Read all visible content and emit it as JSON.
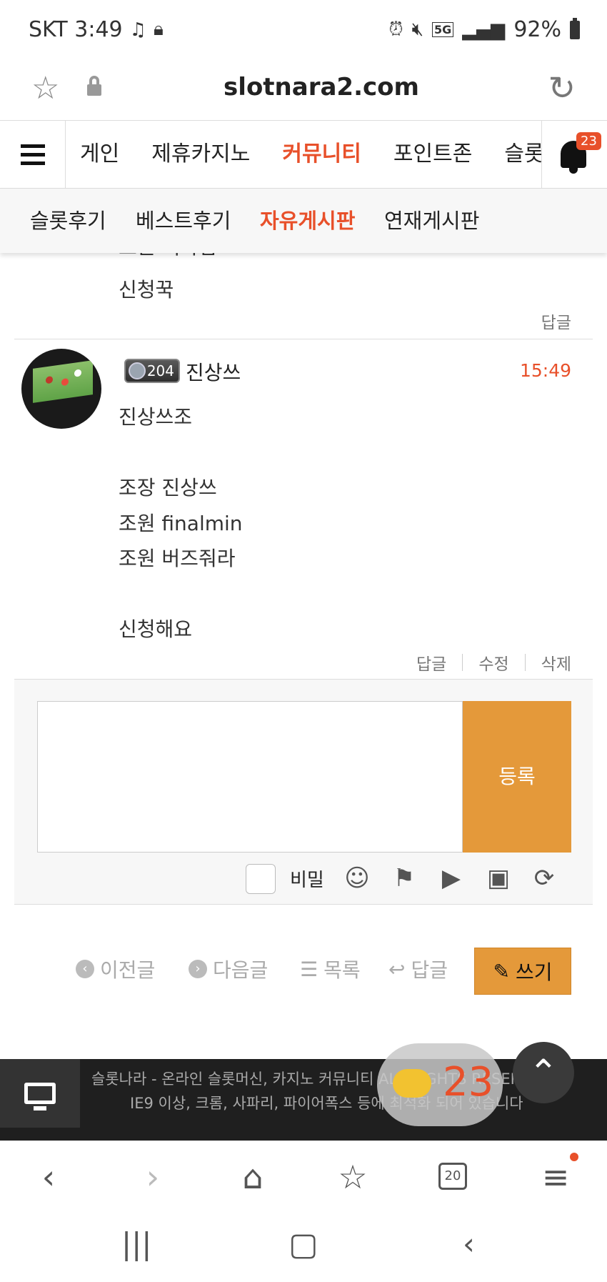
{
  "status_bar": {
    "carrier_time": "SKT 3:49",
    "battery": "92%",
    "network": "5G"
  },
  "url_bar": {
    "url": "slotnara2.com"
  },
  "main_nav": {
    "items": [
      "게인",
      "제휴카지노",
      "커뮤니티",
      "포인트존",
      "슬롯리"
    ],
    "active_index": 2,
    "notification_count": "23"
  },
  "sub_nav": {
    "items": [
      "슬롯후기",
      "베스트후기",
      "자유게시판",
      "연재게시판"
    ],
    "active_index": 2
  },
  "prev_comment": {
    "line1": "조원 띠사귐",
    "line2": "신청꾹",
    "reply": "답글"
  },
  "comment": {
    "level": "204",
    "author": "진상쓰",
    "time": "15:49",
    "lines": [
      "진상쓰조",
      "",
      "조장 진상쓰",
      "조원 finalmin",
      "조원 버즈줘라",
      "",
      "신청해요"
    ],
    "actions": {
      "reply": "답글",
      "edit": "수정",
      "delete": "삭제"
    }
  },
  "comment_form": {
    "submit": "등록",
    "secret_label": "비밀"
  },
  "post_nav": {
    "prev": "이전글",
    "next": "다음글",
    "list": "목록",
    "reply": "답글",
    "write": "쓰기"
  },
  "footer": {
    "line1": "슬롯나라 - 온라인 슬롯머신, 카지노 커뮤니티 ALL RIGHTS RESERVED.",
    "line2": "IE9 이상, 크롬, 사파리, 파이어폭스 등에 최적화 되어 있습니다"
  },
  "chat": {
    "count": "23"
  },
  "browser_bar": {
    "tabs_count": "20"
  },
  "colors": {
    "accent": "#e8502a",
    "button": "#e4993a"
  }
}
